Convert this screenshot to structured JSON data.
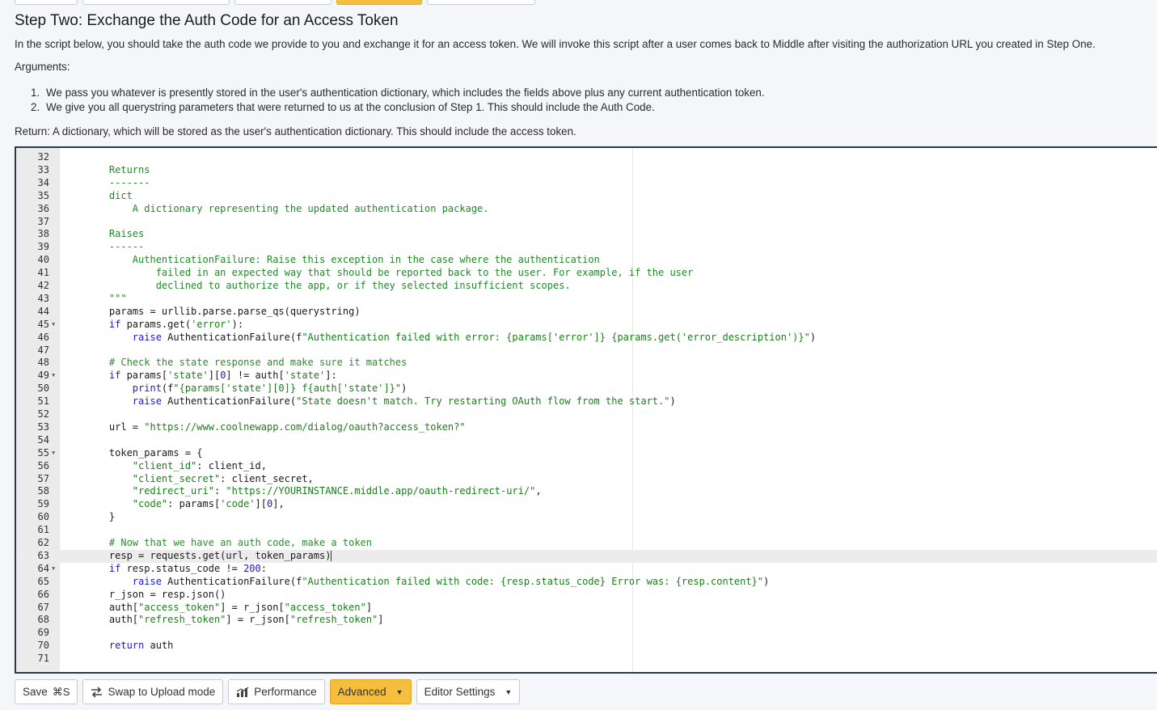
{
  "heading": "Step Two: Exchange the Auth Code for an Access Token",
  "intro": "In the script below, you should take the auth code we provide to you and exchange it for an access token. We will invoke this script after a user comes back to Middle after visiting the authorization URL you created in Step One.",
  "arguments_label": "Arguments:",
  "arguments": [
    {
      "num": "1.",
      "text": "We pass you whatever is presently stored in the user's authentication dictionary, which includes the fields above plus any current authentication token."
    },
    {
      "num": "2.",
      "text": "We give you all querystring parameters that were returned to us at the conclusion of Step 1. This should include the Auth Code."
    }
  ],
  "return_text": "Return: A dictionary, which will be stored as the user's authentication dictionary. This should include the access token.",
  "editor": {
    "active_line": 63,
    "lines": [
      {
        "n": "32",
        "code": ""
      },
      {
        "n": "33",
        "code": "    Returns"
      },
      {
        "n": "34",
        "code": "    -------"
      },
      {
        "n": "35",
        "code": "    dict"
      },
      {
        "n": "36",
        "code": "        A dictionary representing the updated authentication package."
      },
      {
        "n": "37",
        "code": ""
      },
      {
        "n": "38",
        "code": "    Raises"
      },
      {
        "n": "39",
        "code": "    ------"
      },
      {
        "n": "40",
        "code": "        AuthenticationFailure: Raise this exception in the case where the authentication"
      },
      {
        "n": "41",
        "code": "            failed in an expected way that should be reported back to the user. For example, if the user"
      },
      {
        "n": "42",
        "code": "            declined to authorize the app, or if they selected insufficient scopes."
      },
      {
        "n": "43",
        "code": "    \"\"\""
      },
      {
        "n": "44",
        "code": "    params = urllib.parse.parse_qs(querystring)"
      },
      {
        "n": "45",
        "code": "    if params.get('error'):",
        "fold": true
      },
      {
        "n": "46",
        "code": "        raise AuthenticationFailure(f\"Authentication failed with error: {params['error']} {params.get('error_description')}\")"
      },
      {
        "n": "47",
        "code": ""
      },
      {
        "n": "48",
        "code": "    # Check the state response and make sure it matches"
      },
      {
        "n": "49",
        "code": "    if params['state'][0] != auth['state']:",
        "fold": true
      },
      {
        "n": "50",
        "code": "        print(f\"{params['state'][0]} f{auth['state']}\")"
      },
      {
        "n": "51",
        "code": "        raise AuthenticationFailure(\"State doesn't match. Try restarting OAuth flow from the start.\")"
      },
      {
        "n": "52",
        "code": ""
      },
      {
        "n": "53",
        "code": "    url = \"https://www.coolnewapp.com/dialog/oauth?access_token?\""
      },
      {
        "n": "54",
        "code": ""
      },
      {
        "n": "55",
        "code": "    token_params = {",
        "fold": true
      },
      {
        "n": "56",
        "code": "        \"client_id\": client_id,"
      },
      {
        "n": "57",
        "code": "        \"client_secret\": client_secret,"
      },
      {
        "n": "58",
        "code": "        \"redirect_uri\": \"https://YOURINSTANCE.middle.app/oauth-redirect-uri/\","
      },
      {
        "n": "59",
        "code": "        \"code\": params['code'][0],"
      },
      {
        "n": "60",
        "code": "    }"
      },
      {
        "n": "61",
        "code": ""
      },
      {
        "n": "62",
        "code": "    # Now that we have an auth code, make a token"
      },
      {
        "n": "63",
        "code": "    resp = requests.get(url, token_params)"
      },
      {
        "n": "64",
        "code": "    if resp.status_code != 200:",
        "fold": true
      },
      {
        "n": "65",
        "code": "        raise AuthenticationFailure(f\"Authentication failed with code: {resp.status_code} Error was: {resp.content}\")"
      },
      {
        "n": "66",
        "code": "    r_json = resp.json()"
      },
      {
        "n": "67",
        "code": "    auth[\"access_token\"] = r_json[\"access_token\"]"
      },
      {
        "n": "68",
        "code": "    auth[\"refresh_token\"] = r_json[\"refresh_token\"]"
      },
      {
        "n": "69",
        "code": ""
      },
      {
        "n": "70",
        "code": "    return auth"
      },
      {
        "n": "71",
        "code": ""
      }
    ]
  },
  "toolbar": {
    "save_label": "Save",
    "save_shortcut": "⌘S",
    "swap_label": "Swap to Upload mode",
    "performance_label": "Performance",
    "advanced_label": "Advanced",
    "editor_settings_label": "Editor Settings"
  },
  "colors": {
    "accent": "#f5be3c",
    "editor_border": "#2b3a4a",
    "string": "#1a7f1a",
    "keyword": "#1a1ad0"
  }
}
